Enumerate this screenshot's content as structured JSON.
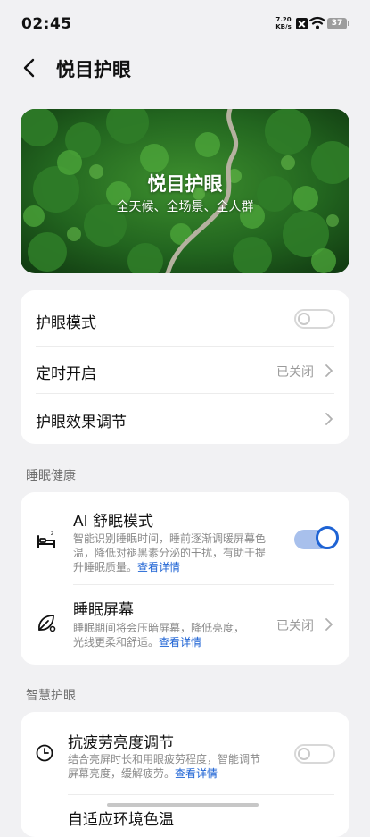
{
  "status": {
    "time": "02:45",
    "net_speed": "7.20",
    "net_unit": "KB/s",
    "battery": "37"
  },
  "header": {
    "title": "悦目护眼"
  },
  "hero": {
    "title": "悦目护眼",
    "subtitle": "全天候、全场景、全人群"
  },
  "main": {
    "eye_mode_label": "护眼模式",
    "eye_mode_on": false,
    "schedule_label": "定时开启",
    "schedule_value": "已关闭",
    "effect_label": "护眼效果调节"
  },
  "sleep": {
    "section_title": "睡眠健康",
    "ai_title": "AI 舒眠模式",
    "ai_desc_1": "智能识别睡眠时间，睡前逐渐调暖屏幕色",
    "ai_desc_2": "温，降低对褪黑素分泌的干扰，有助于提",
    "ai_desc_3": "升睡眠质量。",
    "ai_link": "查看详情",
    "ai_on": true,
    "screen_title": "睡眠屏幕",
    "screen_desc_1": "睡眠期间将会压暗屏幕，降低亮度，",
    "screen_desc_2": "光线更柔和舒适。",
    "screen_link": "查看详情",
    "screen_value": "已关闭"
  },
  "smart": {
    "section_title": "智慧护眼",
    "fatigue_title": "抗疲劳亮度调节",
    "fatigue_desc_1": "结合亮屏时长和用眼疲劳程度，智能调节",
    "fatigue_desc_2": "屏幕亮度，缓解疲劳。",
    "fatigue_link": "查看详情",
    "fatigue_on": false,
    "next_title": "自适应环境色温"
  },
  "icons": {
    "back": "back-arrow-icon",
    "sleep_bed": "bed-icon",
    "leaf": "leaf-icon",
    "clock": "clock-icon"
  },
  "colors": {
    "accent": "#1e63d4",
    "background": "#f1f1f3"
  }
}
